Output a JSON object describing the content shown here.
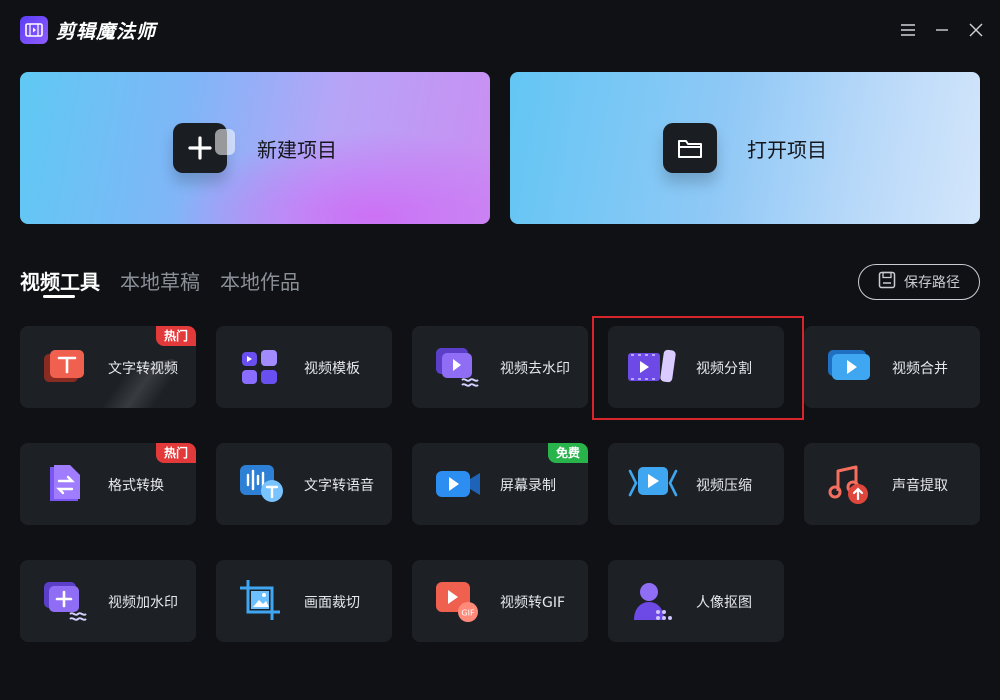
{
  "app": {
    "title": "剪辑魔法师"
  },
  "cards": {
    "new_project": "新建项目",
    "open_project": "打开项目"
  },
  "tabs": [
    {
      "label": "视频工具",
      "active": true
    },
    {
      "label": "本地草稿",
      "active": false
    },
    {
      "label": "本地作品",
      "active": false
    }
  ],
  "save_path_label": "保存路径",
  "tools": [
    {
      "label": "文字转视频",
      "badge": "热门",
      "icon": "text-to-video-icon"
    },
    {
      "label": "视频模板",
      "badge": "",
      "icon": "template-icon"
    },
    {
      "label": "视频去水印",
      "badge": "",
      "icon": "remove-watermark-icon"
    },
    {
      "label": "视频分割",
      "badge": "",
      "icon": "split-video-icon",
      "highlighted": true
    },
    {
      "label": "视频合并",
      "badge": "",
      "icon": "merge-video-icon"
    },
    {
      "label": "格式转换",
      "badge": "热门",
      "icon": "format-convert-icon"
    },
    {
      "label": "文字转语音",
      "badge": "",
      "icon": "text-to-speech-icon"
    },
    {
      "label": "屏幕录制",
      "badge": "免费",
      "icon": "screen-record-icon"
    },
    {
      "label": "视频压缩",
      "badge": "",
      "icon": "compress-video-icon"
    },
    {
      "label": "声音提取",
      "badge": "",
      "icon": "extract-audio-icon"
    },
    {
      "label": "视频加水印",
      "badge": "",
      "icon": "add-watermark-icon"
    },
    {
      "label": "画面裁切",
      "badge": "",
      "icon": "crop-icon"
    },
    {
      "label": "视频转GIF",
      "badge": "",
      "icon": "video-to-gif-icon"
    },
    {
      "label": "人像抠图",
      "badge": "",
      "icon": "portrait-cutout-icon"
    }
  ],
  "colors": {
    "background": "#0f1114",
    "tile": "#1d2025",
    "badge_hot": "#e23a3a",
    "badge_free": "#28b34b",
    "highlight": "#d6262b"
  }
}
